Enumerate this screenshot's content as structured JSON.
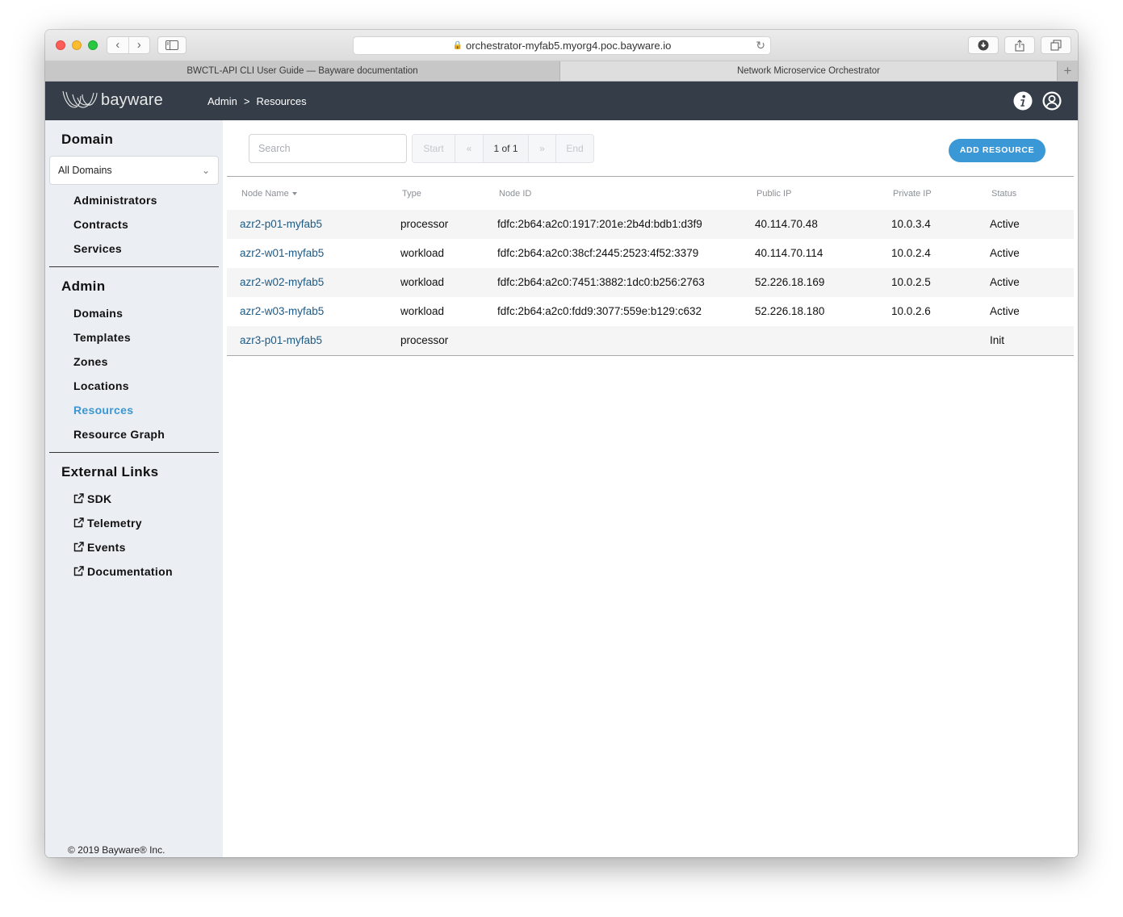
{
  "browser": {
    "url": "orchestrator-myfab5.myorg4.poc.bayware.io",
    "tabs": [
      {
        "title": "BWCTL-API CLI User Guide — Bayware documentation",
        "active": false
      },
      {
        "title": "Network Microservice Orchestrator",
        "active": true
      }
    ],
    "new_tab_label": "+"
  },
  "header": {
    "logo_text": "bayware",
    "breadcrumb": {
      "parent": "Admin",
      "separator": ">",
      "current": "Resources"
    },
    "icons": [
      "info-icon",
      "user-icon"
    ]
  },
  "sidebar": {
    "domain_heading": "Domain",
    "domain_select": {
      "value": "All Domains"
    },
    "domain_items": [
      {
        "label": "Administrators"
      },
      {
        "label": "Contracts"
      },
      {
        "label": "Services"
      }
    ],
    "admin_heading": "Admin",
    "admin_items": [
      {
        "label": "Domains",
        "active": false
      },
      {
        "label": "Templates",
        "active": false
      },
      {
        "label": "Zones",
        "active": false
      },
      {
        "label": "Locations",
        "active": false
      },
      {
        "label": "Resources",
        "active": true
      },
      {
        "label": "Resource Graph",
        "active": false
      }
    ],
    "external_heading": "External Links",
    "external_items": [
      {
        "label": "SDK",
        "icon": "external-link-icon"
      },
      {
        "label": "Telemetry",
        "icon": "external-link-icon"
      },
      {
        "label": "Events",
        "icon": "external-link-icon"
      },
      {
        "label": "Documentation",
        "icon": "external-link-icon"
      }
    ],
    "copyright": "© 2019 Bayware® Inc."
  },
  "main": {
    "search": {
      "placeholder": "Search",
      "value": ""
    },
    "pager": {
      "start": "Start",
      "prev": "«",
      "current": "1 of 1",
      "next": "»",
      "end": "End"
    },
    "add_button": "ADD RESOURCE",
    "table": {
      "columns": [
        "Node Name",
        "Type",
        "Node ID",
        "Public IP",
        "Private IP",
        "Status"
      ],
      "sorted_by": "Node Name",
      "rows": [
        {
          "name": "azr2-p01-myfab5",
          "type": "processor",
          "node_id": "fdfc:2b64:a2c0:1917:201e:2b4d:bdb1:d3f9",
          "public_ip": "40.114.70.48",
          "private_ip": "10.0.3.4",
          "status": "Active"
        },
        {
          "name": "azr2-w01-myfab5",
          "type": "workload",
          "node_id": "fdfc:2b64:a2c0:38cf:2445:2523:4f52:3379",
          "public_ip": "40.114.70.114",
          "private_ip": "10.0.2.4",
          "status": "Active"
        },
        {
          "name": "azr2-w02-myfab5",
          "type": "workload",
          "node_id": "fdfc:2b64:a2c0:7451:3882:1dc0:b256:2763",
          "public_ip": "52.226.18.169",
          "private_ip": "10.0.2.5",
          "status": "Active"
        },
        {
          "name": "azr2-w03-myfab5",
          "type": "workload",
          "node_id": "fdfc:2b64:a2c0:fdd9:3077:559e:b129:c632",
          "public_ip": "52.226.18.180",
          "private_ip": "10.0.2.6",
          "status": "Active"
        },
        {
          "name": "azr3-p01-myfab5",
          "type": "processor",
          "node_id": "",
          "public_ip": "",
          "private_ip": "",
          "status": "Init"
        }
      ]
    }
  },
  "colors": {
    "header_bg": "#353e48",
    "sidebar_bg": "#ebeef2",
    "accent": "#3a98d6",
    "link": "#1f5a84",
    "row_alt": "#f5f5f5"
  }
}
